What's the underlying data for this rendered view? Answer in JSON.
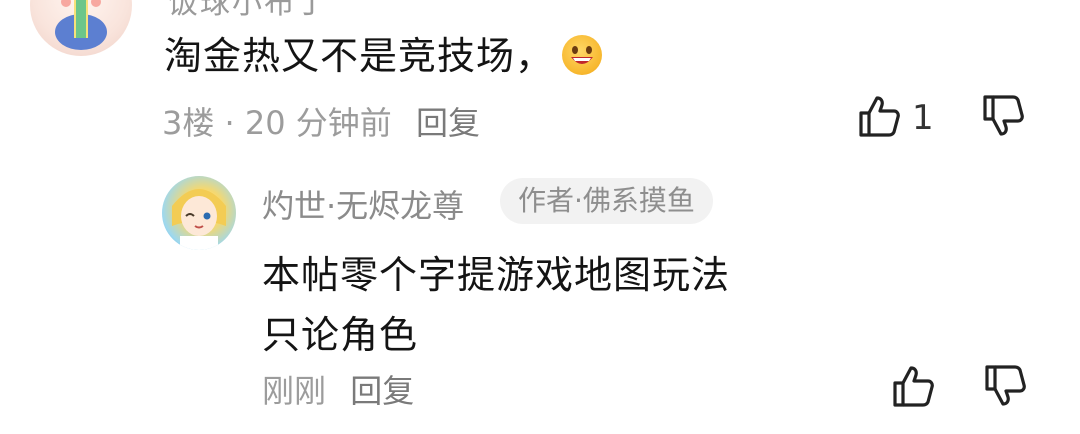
{
  "comment1": {
    "author_partial": "饭球小布丁",
    "text": "淘金热又不是竞技场，",
    "emoji_icon": "grinning-face-icon",
    "floor": "3楼",
    "separator": " · ",
    "time": "20 分钟前",
    "reply_label": "回复",
    "like_count": "1"
  },
  "comment2": {
    "author": "灼世·无烬龙尊",
    "badge": "作者·佛系摸鱼",
    "text_line1": "本帖零个字提游戏地图玩法",
    "text_line2": "只论角色",
    "time": "刚刚",
    "reply_label": "回复"
  },
  "colors": {
    "text_primary": "#141414",
    "text_meta": "#9c9c9c",
    "badge_bg": "#f2f2f2"
  }
}
